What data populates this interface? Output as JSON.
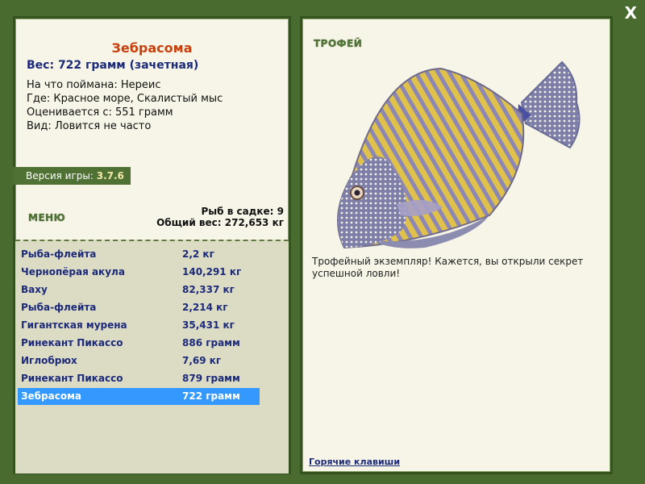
{
  "window": {
    "close_label": "X"
  },
  "fish": {
    "name": "Зебрасома",
    "weight": "Вес: 722 грамм (зачетная)",
    "caught_on": "На что поймана: Нереис",
    "where": "Где: Красное море, Скалистый мыс",
    "rated_from": "Оценивается с: 551 грамм",
    "kind": "Вид: Ловится не часто"
  },
  "version": {
    "label": "Версия игры:",
    "value": "3.7.6"
  },
  "menu": {
    "label": "МЕНЮ"
  },
  "cage": {
    "count": "Рыб в садке: 9",
    "total": "Общий вес: 272,653 кг"
  },
  "catch_list": [
    {
      "name": "Рыба-флейта",
      "weight": "2,2 кг"
    },
    {
      "name": "Чернопёрая акула",
      "weight": "140,291 кг"
    },
    {
      "name": "Ваху",
      "weight": "82,337 кг"
    },
    {
      "name": "Рыба-флейта",
      "weight": "2,214 кг"
    },
    {
      "name": "Гигантская мурена",
      "weight": "35,431 кг"
    },
    {
      "name": "Ринекант Пикассо",
      "weight": "886 грамм"
    },
    {
      "name": "Иглобрюх",
      "weight": "7,69 кг"
    },
    {
      "name": "Ринекант Пикассо",
      "weight": "879 грамм"
    },
    {
      "name": "Зебрасома",
      "weight": "722 грамм",
      "selected": true
    }
  ],
  "trophy": {
    "label": "ТРОФЕЙ",
    "text": "Трофейный экземпляр! Кажется, вы открыли секрет успешной ловли!"
  },
  "hotkeys": {
    "label": "Горячие клавиши"
  },
  "colors": {
    "bg": "#4a6b2f",
    "panel": "#f6f5e7",
    "accent_green": "#4f7234",
    "title_orange": "#c8400e",
    "text_blue": "#1c2a7a",
    "selection": "#3399ff"
  }
}
